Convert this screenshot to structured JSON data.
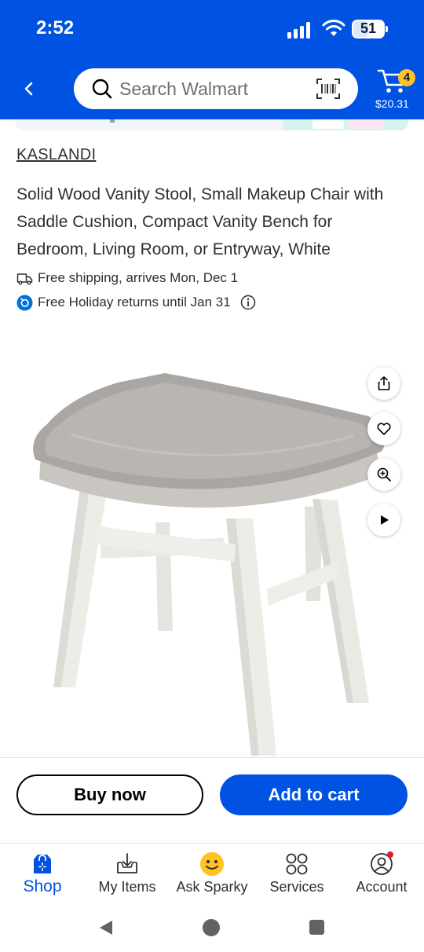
{
  "status_bar": {
    "time": "2:52",
    "battery": "51",
    "battery_level": 0.51
  },
  "header": {
    "search": {
      "placeholder": "Search Walmart"
    },
    "cart": {
      "count": "4",
      "total": "$20.31"
    },
    "accent_color": "#0053e2",
    "badge_color": "#ffc220"
  },
  "product": {
    "brand": "KASLANDI",
    "title": "Solid Wood Vanity Stool, Small Makeup Chair with Saddle Cushion, Compact Vanity Bench for Bedroom, Living Room, or Entryway, White",
    "shipping": "Free shipping, arrives Mon, Dec 1",
    "returns": "Free Holiday returns until Jan 31"
  },
  "image_actions": [
    "share-icon",
    "heart-icon",
    "zoom-in-icon",
    "play-icon"
  ],
  "actions": {
    "buy_now": "Buy now",
    "add_to_cart": "Add to cart"
  },
  "bottom_nav": [
    {
      "label": "Shop",
      "icon": "shop-icon",
      "active": true
    },
    {
      "label": "My Items",
      "icon": "my-items-icon",
      "active": false
    },
    {
      "label": "Ask Sparky",
      "icon": "sparky-icon",
      "active": false
    },
    {
      "label": "Services",
      "icon": "services-icon",
      "active": false
    },
    {
      "label": "Account",
      "icon": "account-icon",
      "active": false
    }
  ]
}
